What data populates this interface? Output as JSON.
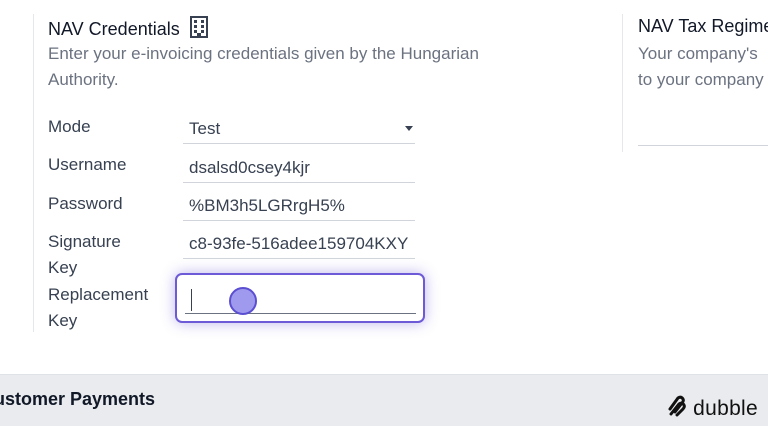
{
  "nav_credentials": {
    "title": "NAV Credentials",
    "title_icon": "building-icon",
    "description_line1": "Enter your e-invoicing credentials given by the Hungarian",
    "description_line2": "Authority.",
    "fields": [
      {
        "label": "Mode",
        "value": "Test",
        "type": "select"
      },
      {
        "label": "Username",
        "value": "dsalsd0csey4kjr",
        "type": "text"
      },
      {
        "label": "Password",
        "value": "%BM3h5LGRrgH5%",
        "type": "text"
      },
      {
        "label_line1": "Signature",
        "label_line2": "Key",
        "value": "c8-93fe-516adee159704KXY",
        "type": "text"
      },
      {
        "label_line1": "Replacement",
        "label_line2": "Key",
        "value": "",
        "type": "text",
        "focused": true
      }
    ]
  },
  "nav_tax_regime": {
    "title": "NAV Tax Regime",
    "description_line1": "Your company's",
    "description_line2": "to your company"
  },
  "bottom_section": {
    "title": "ustomer Payments"
  },
  "branding": {
    "name": "dubble",
    "icon": "dubble-logo-icon"
  },
  "colors": {
    "focus_accent": "#6d5ad6",
    "click_indicator": "#7c73e8"
  }
}
